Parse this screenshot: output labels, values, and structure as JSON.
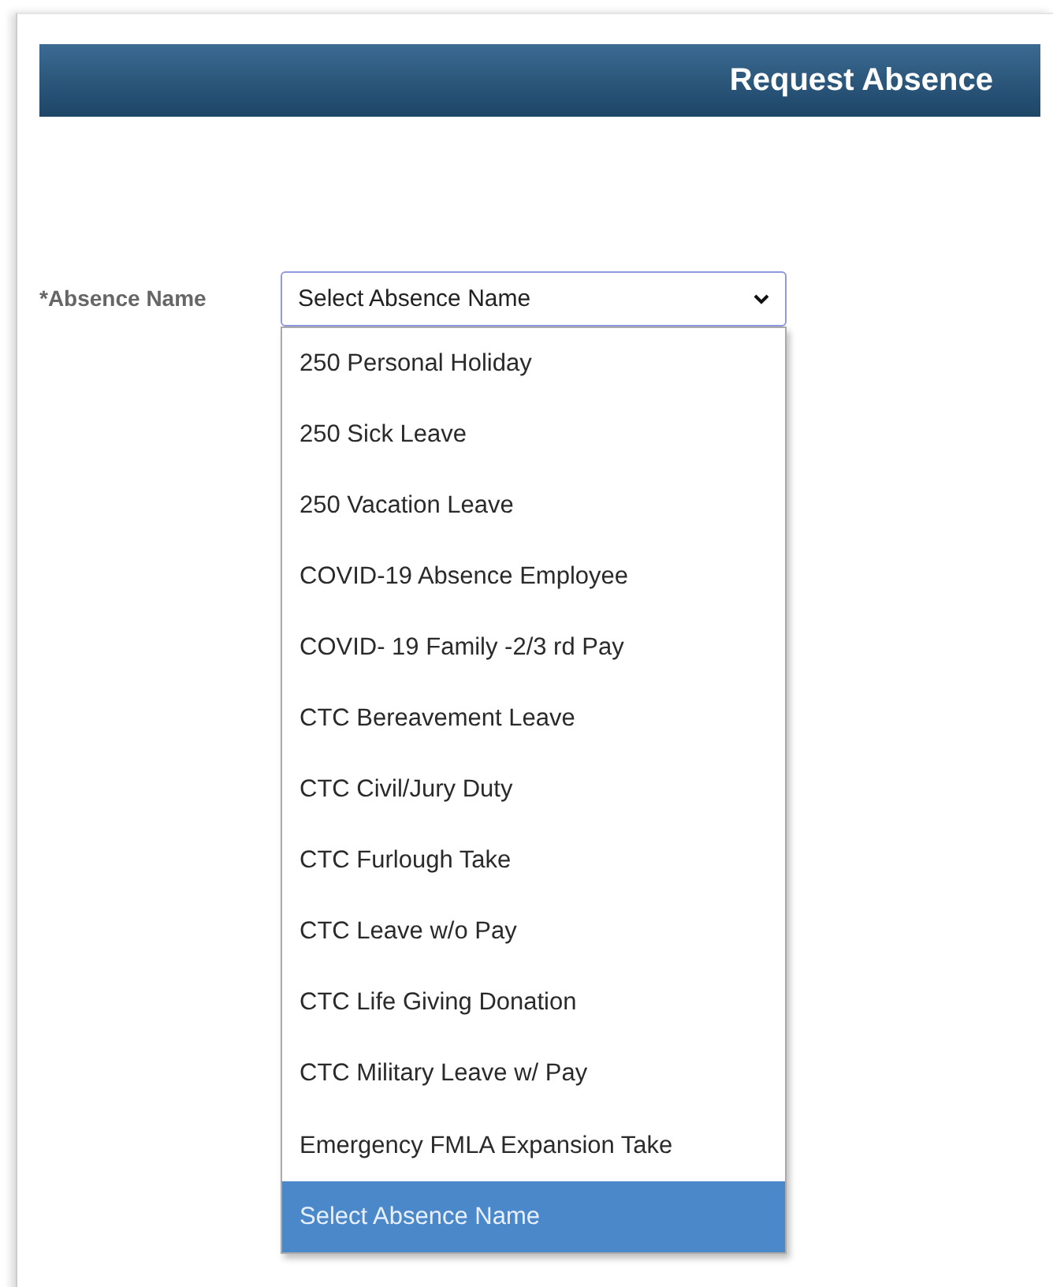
{
  "header": {
    "title": "Request Absence"
  },
  "field": {
    "label": "*Absence Name",
    "value": "Select Absence Name",
    "expanded": true
  },
  "options": [
    {
      "label": "250 Personal Holiday",
      "selected": false
    },
    {
      "label": "250 Sick Leave",
      "selected": false
    },
    {
      "label": "250 Vacation Leave",
      "selected": false
    },
    {
      "label": "COVID-19 Absence Employee",
      "selected": false
    },
    {
      "label": "COVID- 19 Family -2/3 rd Pay",
      "selected": false
    },
    {
      "label": "CTC Bereavement Leave",
      "selected": false
    },
    {
      "label": "CTC Civil/Jury Duty",
      "selected": false
    },
    {
      "label": "CTC Furlough Take",
      "selected": false
    },
    {
      "label": "CTC Leave w/o Pay",
      "selected": false
    },
    {
      "label": "CTC Life Giving Donation",
      "selected": false
    },
    {
      "label": "CTC Military Leave w/ Pay",
      "selected": false
    },
    {
      "label": "Emergency FMLA Expansion Take",
      "selected": false
    },
    {
      "label": "Select Absence Name",
      "selected": true
    }
  ]
}
